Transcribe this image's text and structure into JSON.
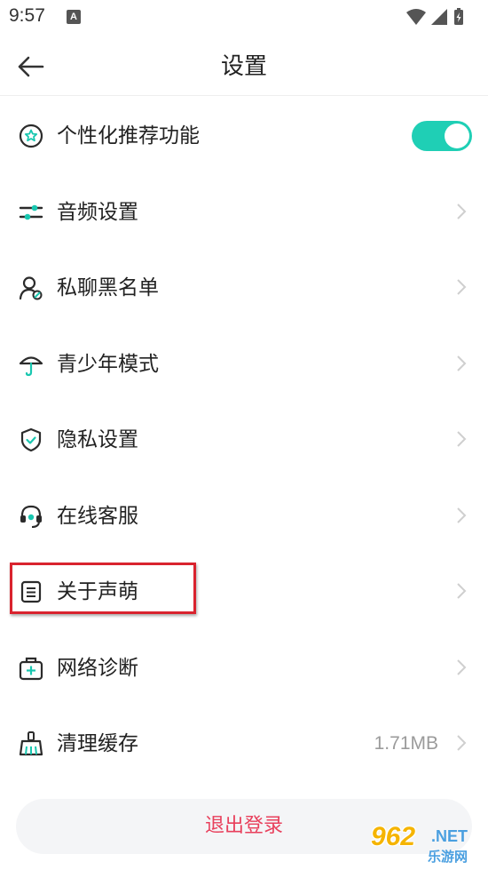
{
  "status_bar": {
    "time": "9:57",
    "notification_letter": "A"
  },
  "header": {
    "title": "设置"
  },
  "settings": {
    "items": [
      {
        "label": "个性化推荐功能",
        "icon": "star-badge-icon",
        "control": "toggle",
        "toggle_on": true
      },
      {
        "label": "音频设置",
        "icon": "sliders-icon",
        "control": "chevron"
      },
      {
        "label": "私聊黑名单",
        "icon": "user-block-icon",
        "control": "chevron"
      },
      {
        "label": "青少年模式",
        "icon": "umbrella-icon",
        "control": "chevron"
      },
      {
        "label": "隐私设置",
        "icon": "shield-check-icon",
        "control": "chevron"
      },
      {
        "label": "在线客服",
        "icon": "headset-icon",
        "control": "chevron"
      },
      {
        "label": "关于声萌",
        "icon": "document-icon",
        "control": "chevron",
        "highlighted": true
      },
      {
        "label": "网络诊断",
        "icon": "medical-kit-icon",
        "control": "chevron"
      },
      {
        "label": "清理缓存",
        "icon": "broom-icon",
        "control": "chevron",
        "value": "1.71MB"
      }
    ]
  },
  "logout": {
    "label": "退出登录"
  },
  "watermark": {
    "number": "962",
    "suffix": ".NET",
    "site": "乐游网"
  },
  "colors": {
    "accent": "#1fcfb5",
    "icon_accent": "#19c7b0",
    "logout_text": "#e8405c",
    "highlight": "#d9232e"
  }
}
